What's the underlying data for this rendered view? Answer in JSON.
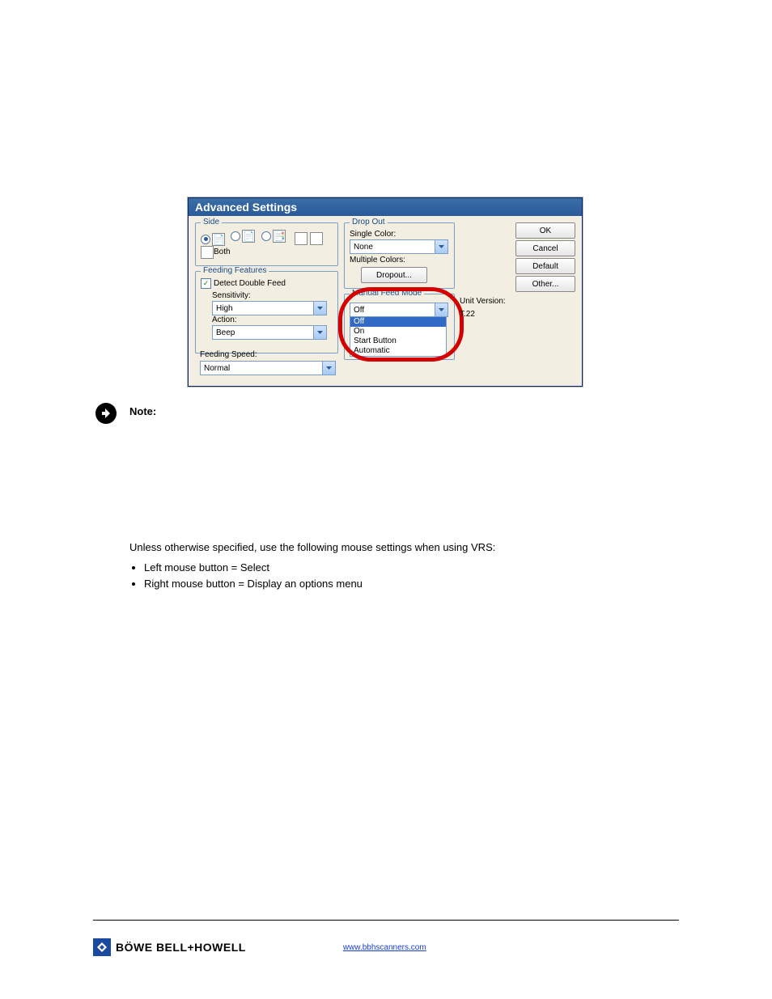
{
  "dialog": {
    "title": "Advanced Settings",
    "side": {
      "legend": "Side",
      "both": "Both"
    },
    "feeding": {
      "legend": "Feeding Features",
      "detect": "Detect Double Feed",
      "sensitivity_label": "Sensitivity:",
      "sensitivity_value": "High",
      "action_label": "Action:",
      "action_value": "Beep",
      "speed_label": "Feeding Speed:",
      "speed_value": "Normal"
    },
    "dropout": {
      "legend": "Drop Out",
      "single_color_label": "Single Color:",
      "single_color_value": "None",
      "multiple_colors_label": "Multiple Colors:",
      "dropout_button": "Dropout..."
    },
    "manual": {
      "legend": "Manual Feed Mode",
      "value": "Off",
      "options": [
        "Off",
        "On",
        "Start Button",
        "Automatic"
      ]
    },
    "unit_version_label": "Unit Version:",
    "unit_version_value": "T.22",
    "buttons": {
      "ok": "OK",
      "cancel": "Cancel",
      "default": "Default",
      "other": "Other..."
    }
  },
  "note": {
    "label": "Note:",
    "line1": "Unless otherwise specified, use the following mouse settings when using VRS:",
    "bullet1": "Left mouse button = Select",
    "bullet2": "Right mouse button = Display an options menu"
  },
  "footer": {
    "brand": "BÖWE BELL+HOWELL",
    "link": "www.bbhscanners.com"
  }
}
